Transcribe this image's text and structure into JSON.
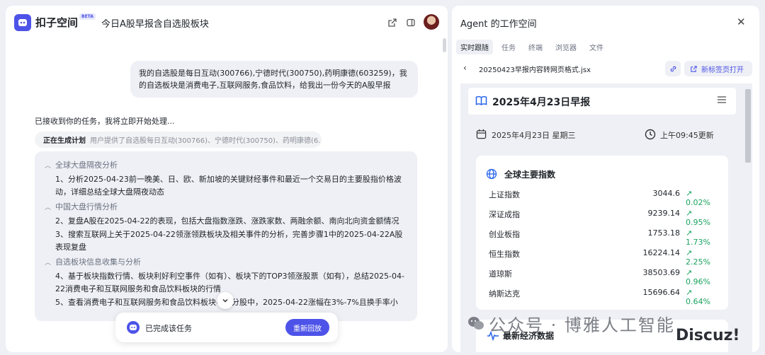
{
  "app": {
    "name": "扣子空间",
    "badge": "BETA",
    "chat_title": "今日A股早报含自选股板块"
  },
  "chat": {
    "user_message": "我的自选股是每日互动(300766),宁德时代(300750),药明康德(603259)，我的自选板块是消费电子,互联网服务,食品饮料，给我出一份今天的A股早报",
    "assistant_reply": "已接收到你的任务，我将立即开始处理...",
    "plan_status": "正在生成计划",
    "plan_summary": "用户提供了自选股每日互动(300766)、宁德时代(300750)、药明康德(6...",
    "sections": [
      {
        "title": "全球大盘隔夜分析",
        "items": [
          "1、分析2025-04-23前一晚美、日、欧、新加坡的关键财经事件和最近一个交易日的主要股指价格波动，详细总结全球大盘隔夜动态"
        ]
      },
      {
        "title": "中国大盘行情分析",
        "items": [
          "2、复盘A股在2025-04-22的表现，包括大盘指数涨跌、涨跌家数、两融余额、南向北向资金额情况",
          "3、搜索互联网上关于2025-04-22领涨领跌板块及相关事件的分析，完善步骤1中的2025-04-22A股表现复盘"
        ]
      },
      {
        "title": "自选板块信息收集与分析",
        "items": [
          "4、基于板块指数行情、板块利好利空事件（如有）、板块下的TOP3领涨股票（如有），总结2025-04-22消费电子和互联网服务和食品饮料板块的行情",
          "5、查看消费电子和互联网服务和食品饮料板块中成分股中，2025-04-22涨幅在3%-7%且换手率小"
        ]
      }
    ],
    "done_text": "已完成该任务",
    "replay_label": "重新回放"
  },
  "workspace": {
    "title": "Agent 的工作空间",
    "tabs": [
      "实时跟随",
      "任务",
      "终端",
      "浏览器",
      "文件"
    ],
    "active_tab": 0,
    "file_name": "20250423早报内容转网页格式.jsx",
    "open_new_tab": "新标签页打开"
  },
  "report": {
    "title": "2025年4月23日早报",
    "date": "2025年4月23日 星期三",
    "update_time": "上午09:45更新",
    "indices_title": "全球主要指数",
    "indices": [
      {
        "name": "上证指数",
        "value": "3044.6",
        "change": "0.02%"
      },
      {
        "name": "深证成指",
        "value": "9239.14",
        "change": "0.95%"
      },
      {
        "name": "创业板指",
        "value": "1753.18",
        "change": "1.73%"
      },
      {
        "name": "恒生指数",
        "value": "16224.14",
        "change": "2.25%"
      },
      {
        "name": "道琼斯",
        "value": "38503.69",
        "change": "0.96%"
      },
      {
        "name": "纳斯达克",
        "value": "15696.64",
        "change": "0.64%"
      }
    ],
    "economy_title": "最新经济数据",
    "up_color": "#1aa35f"
  },
  "watermark": {
    "text": "公众号 · 博雅人工智能",
    "site": "Discuz!"
  }
}
